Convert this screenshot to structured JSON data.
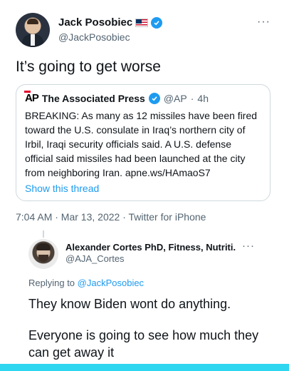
{
  "author": {
    "name": "Jack Posobiec",
    "handle": "@JackPosobiec",
    "flag_icon": "us-flag-icon",
    "verified_icon": "verified-badge-icon"
  },
  "more_label": "···",
  "tweet": {
    "text": "It’s going to get worse"
  },
  "quoted": {
    "logo": "AP",
    "name": "The Associated Press",
    "handle": "@AP",
    "separator": "·",
    "time": "4h",
    "text": "BREAKING: As many as 12 missiles have been fired toward the U.S. consulate in Iraq’s northern city of Irbil, Iraqi security officials said. A U.S. defense official said missiles had been launched at the city from neighboring Iran. apne.ws/HAmaoS7",
    "show_thread": "Show this thread"
  },
  "meta": {
    "line": "7:04 AM · Mar 13, 2022 · Twitter for iPhone"
  },
  "reply": {
    "name": "Alexander Cortes PhD, Fitness, Nutriti...",
    "handle": "@AJA_Cortes",
    "replying_prefix": "Replying to ",
    "replying_mention": "@JackPosobiec",
    "paragraphs": [
      "They know Biden wont do anything.",
      "Everyone is going to see how much they can get away it"
    ]
  },
  "colors": {
    "link": "#1d9bf0",
    "muted": "#536471",
    "border": "#cfd9de",
    "bottom_bar": "#2fd6ef"
  }
}
